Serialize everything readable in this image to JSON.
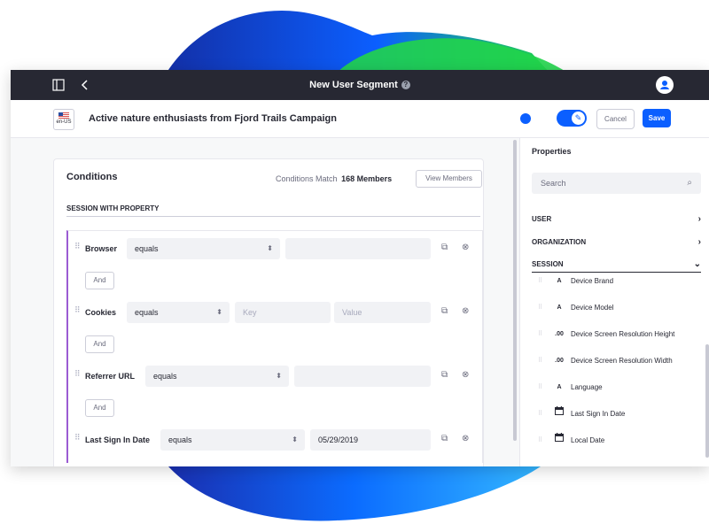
{
  "topbar": {
    "title": "New User Segment",
    "help": "?"
  },
  "header": {
    "locale": "en-US",
    "segment_name": "Active nature enthusiasts from Fjord Trails Campaign",
    "cancel_label": "Cancel",
    "save_label": "Save"
  },
  "conditions": {
    "title": "Conditions",
    "match_label": "Conditions Match",
    "match_count": "168 Members",
    "view_members_label": "View Members",
    "section": "SESSION WITH PROPERTY",
    "and_label": "And",
    "rows": [
      {
        "property": "Browser",
        "operator": "equals",
        "value": ""
      },
      {
        "property": "Cookies",
        "operator": "equals",
        "key_placeholder": "Key",
        "value_placeholder": "Value"
      },
      {
        "property": "Referrer URL",
        "operator": "equals",
        "value": ""
      },
      {
        "property": "Last Sign In Date",
        "operator": "equals",
        "value": "05/29/2019"
      }
    ]
  },
  "properties": {
    "title": "Properties",
    "search_placeholder": "Search",
    "categories": [
      "USER",
      "ORGANIZATION",
      "SESSION"
    ],
    "session_items": [
      {
        "type": "A",
        "name": "Device Brand"
      },
      {
        "type": "A",
        "name": "Device Model"
      },
      {
        "type": ".00",
        "name": "Device Screen Resolution Height"
      },
      {
        "type": ".00",
        "name": "Device Screen Resolution Width"
      },
      {
        "type": "A",
        "name": "Language"
      },
      {
        "type": "calendar-icon",
        "name": "Last Sign In Date"
      },
      {
        "type": "calendar-icon",
        "name": "Local Date"
      }
    ]
  },
  "colors": {
    "topbar": "#272833",
    "primary": "#0b5fff",
    "criteria_border": "#9b5bd3"
  }
}
